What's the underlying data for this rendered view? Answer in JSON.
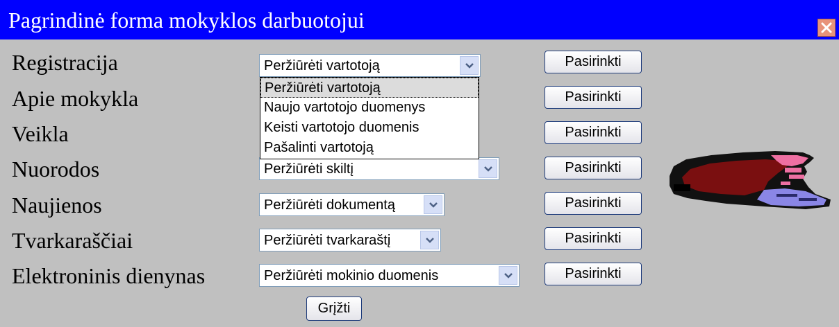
{
  "window": {
    "title": "Pagrindinė forma mokyklos darbuotojui"
  },
  "rows": [
    {
      "label": "Registracija",
      "selected": "Peržiūrėti vartotoją",
      "button": "Pasirinkti"
    },
    {
      "label": "Apie mokykla",
      "button": "Pasirinkti"
    },
    {
      "label": "Veikla",
      "button": "Pasirinkti"
    },
    {
      "label": "Nuorodos",
      "selected": "Peržiūrėti skiltį",
      "button": "Pasirinkti"
    },
    {
      "label": "Naujienos",
      "selected": "Peržiūrėti dokumentą",
      "button": "Pasirinkti"
    },
    {
      "label": "Tvarkaraščiai",
      "selected": "Peržiūrėti tvarkaraštį",
      "button": "Pasirinkti"
    },
    {
      "label": "Elektroninis dienynas",
      "selected": "Peržiūrėti mokinio duomenis",
      "button": "Pasirinkti"
    }
  ],
  "dropdown_options": [
    "Peržiūrėti vartotoją",
    "Naujo vartotojo duomenys",
    "Keisti vartotojo duomenis",
    "Pašalinti vartotoją"
  ],
  "back_button": "Grįžti",
  "icons": {
    "close": "close-icon",
    "arrow": "chevron-down-icon",
    "decoration": "book-icon"
  },
  "colors": {
    "titlebar": "#0000ff",
    "background": "#c0c0c0",
    "close": "#e8937a"
  }
}
